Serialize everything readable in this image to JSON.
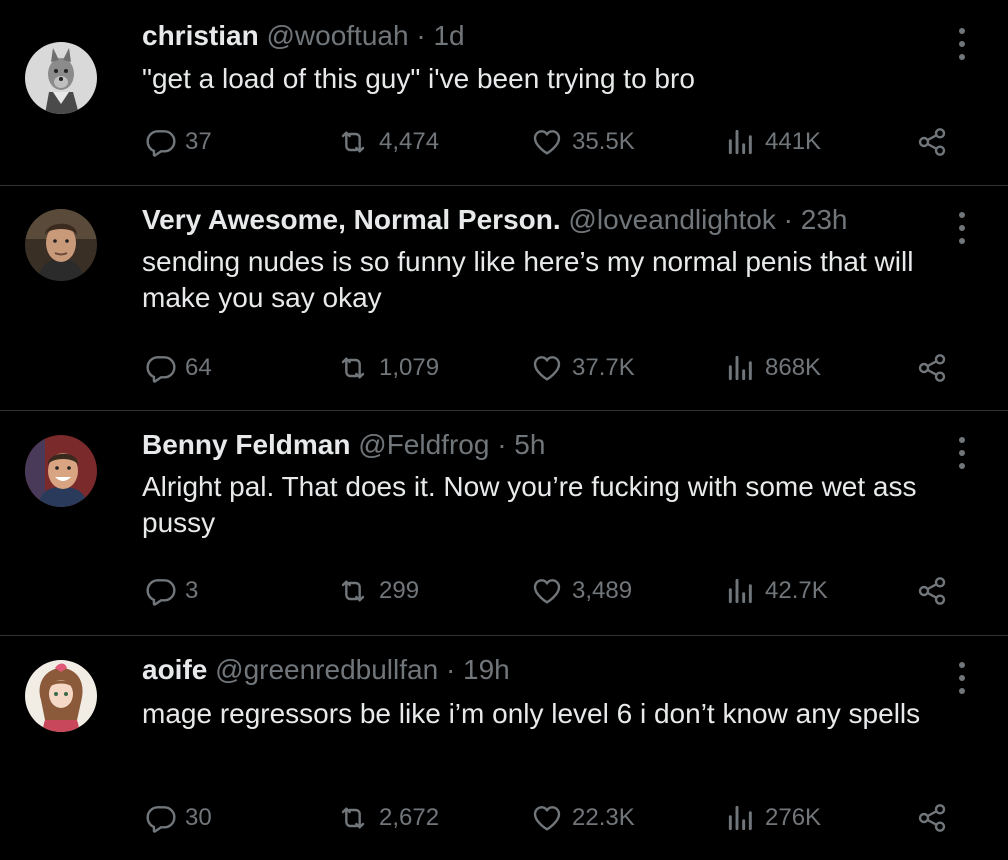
{
  "tweets": [
    {
      "name": "christian",
      "handle": "@wooftuah",
      "time": "· 1d",
      "text": "\"get a load of this guy\" i've been trying to bro",
      "replies": "37",
      "reposts": "4,474",
      "likes": "35.5K",
      "views": "441K",
      "avatar": "wolf-furry-avatar"
    },
    {
      "name": "Very Awesome, Normal Person.",
      "handle": "@loveandlightok",
      "time": "· 23h",
      "text": "sending nudes is so funny like here’s my normal penis that will make you say okay",
      "replies": "64",
      "reposts": "1,079",
      "likes": "37.7K",
      "views": "868K",
      "avatar": "man-photo-avatar"
    },
    {
      "name": "Benny Feldman",
      "handle": "@Feldfrog",
      "time": "· 5h",
      "text": "Alright pal. That does it. Now you’re fucking with some wet ass pussy",
      "replies": "3",
      "reposts": "299",
      "likes": "3,489",
      "views": "42.7K",
      "avatar": "smiling-man-avatar"
    },
    {
      "name": "aoife",
      "handle": "@greenredbullfan",
      "time": "· 19h",
      "text": "mage regressors be like i’m only level 6 i don’t know any spells",
      "replies": "30",
      "reposts": "2,672",
      "likes": "22.3K",
      "views": "276K",
      "avatar": "anime-girl-avatar"
    }
  ],
  "colors": {
    "background": "#000000",
    "text": "#e7e9ea",
    "muted": "#71767b",
    "divider": "#2f3336"
  },
  "icons": {
    "reply": "reply-icon",
    "repost": "repost-icon",
    "like": "heart-icon",
    "views": "views-icon",
    "share": "share-icon",
    "more": "more-icon"
  }
}
